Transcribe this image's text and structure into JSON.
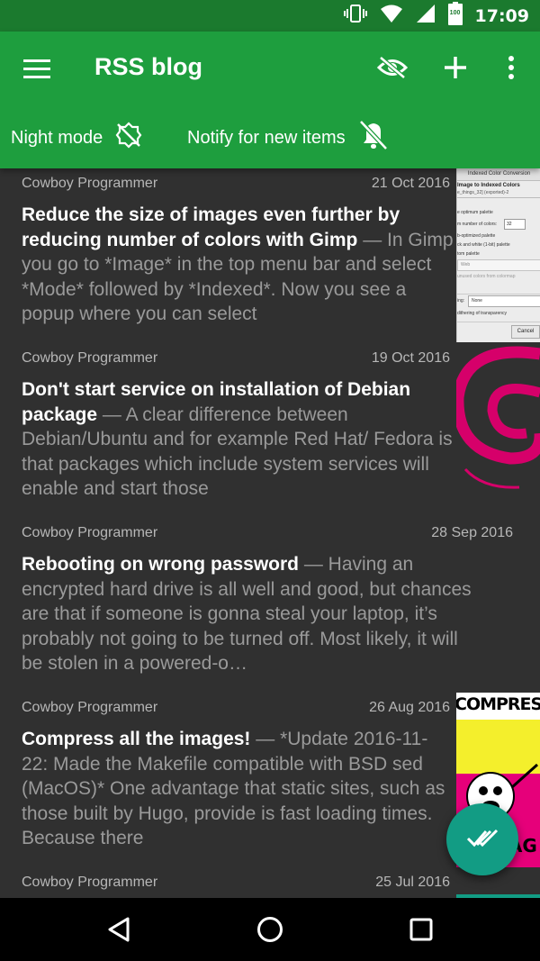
{
  "status_bar": {
    "time": "17:09",
    "icons": [
      "vibrate-icon",
      "wifi-icon",
      "signal-icon",
      "battery-icon"
    ],
    "battery_label": "100"
  },
  "toolbar": {
    "title": "RSS blog",
    "actions": [
      "visibility-off-icon",
      "add-icon",
      "more-vert-icon"
    ],
    "night_mode_label": "Night mode",
    "notify_label": "Notify for new items"
  },
  "items": [
    {
      "feed": "Cowboy Programmer",
      "date": "21 Oct 2016",
      "headline": "Reduce the size of images even further by reducing number of colors with Gimp",
      "snippet": " — In Gimp you go to *Image* in the top menu bar and select *Mode* followed by *Indexed*. Now you see a popup where you can select",
      "thumbnail": {
        "title": "Indexed Color Conversion",
        "heading": "Image to Indexed Colors",
        "subheading": "e_things_32] (exported)-2",
        "lines": [
          "e optimum palette",
          "m number of colors:",
          "b-optimized palette",
          "ck and white (1-bit) palette",
          "tom palette",
          "Web",
          "unused colors from colormap",
          "ing:",
          "None",
          "dithering of transparency"
        ],
        "number_value": "32",
        "button": "Cancel"
      }
    },
    {
      "feed": "Cowboy Programmer",
      "date": "19 Oct 2016",
      "headline": "Don't start service on installation of Debian package",
      "snippet": " — A clear difference between Debian/Ubuntu and for example Red Hat/ Fedora is that packages which include system services will enable and start those"
    },
    {
      "feed": "Cowboy Programmer",
      "date": "28 Sep 2016",
      "headline": "Rebooting on wrong password",
      "snippet": " — Having an encrypted hard drive is all well and good, but chances are that if someone is gonna steal your laptop, it’s probably not going to be turned off. Most likely, it will be stolen in a powered-o…"
    },
    {
      "feed": "Cowboy Programmer",
      "date": "26 Aug 2016",
      "headline": "Compress all the images!",
      "snippet": " — *Update 2016-11-22: Made the Makefile compatible with BSD sed (MacOS)* One advantage that static sites, such as those built by Hugo, provide is fast loading times. Because there",
      "thumbnail": {
        "text_top": "COMPRESS",
        "text_bottom": "MAG"
      }
    },
    {
      "feed": "Cowboy Programmer",
      "date": "25 Jul 2016",
      "headline": "",
      "snippet": ""
    }
  ],
  "fab": {
    "icon": "done-all-icon"
  },
  "nav": {
    "icons": [
      "back-icon",
      "home-icon",
      "recents-icon"
    ]
  },
  "colors": {
    "status_bar": "#1b7a2e",
    "toolbar": "#1e9e3e",
    "background": "#303030",
    "fab": "#129c84",
    "headline": "#ffffff",
    "snippet": "#9a9a9a",
    "meta": "#b7b7b7"
  }
}
